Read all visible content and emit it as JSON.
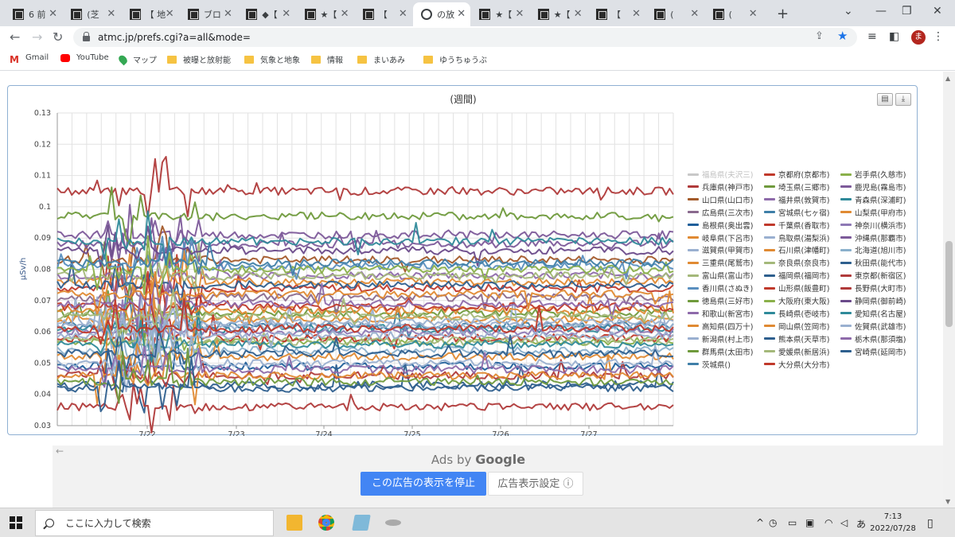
{
  "browser": {
    "tabs": [
      {
        "title": "6 前",
        "icon": "site-icon"
      },
      {
        "title": "(芝",
        "icon": "site-icon"
      },
      {
        "title": "【 地",
        "icon": "site-icon"
      },
      {
        "title": "ブロ",
        "icon": "info-icon"
      },
      {
        "title": "◆【",
        "icon": "site-icon"
      },
      {
        "title": "★【",
        "icon": "site-icon"
      },
      {
        "title": "【",
        "icon": "site-icon"
      },
      {
        "title": "の放",
        "icon": "globe-icon",
        "active": true
      },
      {
        "title": "★【",
        "icon": "site-icon"
      },
      {
        "title": "★【",
        "icon": "site-icon"
      },
      {
        "title": "【",
        "icon": "site-icon"
      },
      {
        "title": "(",
        "icon": "site-icon"
      },
      {
        "title": "(",
        "icon": "site-icon"
      }
    ],
    "url": "atmc.jp/prefs.cgi?a=all&mode=",
    "profile_initial": "ま",
    "bookmarks": [
      {
        "label": "Gmail",
        "icon": "gmail-icon"
      },
      {
        "label": "YouTube",
        "icon": "youtube-icon"
      },
      {
        "label": "マップ",
        "icon": "maps-icon"
      },
      {
        "label": "被曝と放射能",
        "icon": "folder-icon"
      },
      {
        "label": "気象と地象",
        "icon": "folder-icon"
      },
      {
        "label": "情報",
        "icon": "folder-icon"
      },
      {
        "label": "まいあみ",
        "icon": "folder-icon"
      },
      {
        "label": "ゆうちゅうぶ",
        "icon": "folder-icon"
      }
    ]
  },
  "chart_data": {
    "type": "line",
    "title": "(週間)",
    "ylabel": "μSv/h",
    "ylim": [
      0.03,
      0.13
    ],
    "yticks": [
      "0.03",
      "0.04",
      "0.05",
      "0.06",
      "0.07",
      "0.08",
      "0.09",
      "0.1",
      "0.11",
      "0.12",
      "0.13"
    ],
    "xticks": [
      "7/22",
      "7/23",
      "7/24",
      "7/25",
      "7/26",
      "7/27"
    ],
    "grid": true,
    "legend_position": "right",
    "series": [
      {
        "name": "福島県(夫沢三)",
        "color": "#c8c8c8",
        "dim": true,
        "level": null
      },
      {
        "name": "京都府(京都市)",
        "color": "#c0392b",
        "level": 0.074
      },
      {
        "name": "岩手県(久慈市)",
        "color": "#8ab04a",
        "level": 0.057
      },
      {
        "name": "兵庫県(神戸市)",
        "color": "#b03a3a",
        "level": 0.105
      },
      {
        "name": "埼玉県(三郷市)",
        "color": "#6f9a3c",
        "level": 0.066
      },
      {
        "name": "鹿児島(霧島市)",
        "color": "#7d5a9a",
        "level": 0.091
      },
      {
        "name": "山口県(山口市)",
        "color": "#a35a2a",
        "level": 0.083
      },
      {
        "name": "福井県(敦賀市)",
        "color": "#8e6aaa",
        "level": 0.078
      },
      {
        "name": "青森県(深浦町)",
        "color": "#2f8a9a",
        "level": 0.061
      },
      {
        "name": "広島県(三次市)",
        "color": "#8a6a8e",
        "level": 0.071
      },
      {
        "name": "宮城県(七ヶ宿)",
        "color": "#3f7fa8",
        "level": 0.062
      },
      {
        "name": "山梨県(甲府市)",
        "color": "#e08a33",
        "level": 0.064
      },
      {
        "name": "島根県(奥出雲)",
        "color": "#1f5f9a",
        "level": 0.049
      },
      {
        "name": "千葉県(香取市)",
        "color": "#c0392b",
        "level": 0.058
      },
      {
        "name": "神奈川(横浜市)",
        "color": "#8e79b5",
        "level": 0.06
      },
      {
        "name": "岐阜県(下呂市)",
        "color": "#e08a33",
        "level": 0.076
      },
      {
        "name": "鳥取県(湯梨浜)",
        "color": "#9ab0d0",
        "level": 0.062
      },
      {
        "name": "沖縄県(那覇市)",
        "color": "#7d5a9a",
        "level": 0.088
      },
      {
        "name": "滋賀県(甲賀市)",
        "color": "#9ab0d0",
        "level": 0.063
      },
      {
        "name": "石川県(津幡町)",
        "color": "#e08a33",
        "level": 0.067
      },
      {
        "name": "北海道(旭川市)",
        "color": "#8ab0cc",
        "level": 0.054
      },
      {
        "name": "三重県(尾鷲市)",
        "color": "#e08a33",
        "level": 0.052
      },
      {
        "name": "奈良県(奈良市)",
        "color": "#a4b87a",
        "level": 0.057
      },
      {
        "name": "秋田県(能代市)",
        "color": "#2e5f8e",
        "level": 0.043
      },
      {
        "name": "富山県(富山市)",
        "color": "#a4b87a",
        "level": 0.078
      },
      {
        "name": "福岡県(福岡市)",
        "color": "#2e5f8e",
        "level": 0.075
      },
      {
        "name": "東京都(新宿区)",
        "color": "#b03a3a",
        "level": 0.036
      },
      {
        "name": "香川県(さぬき)",
        "color": "#5a8fbf",
        "level": 0.081
      },
      {
        "name": "山形県(飯豊町)",
        "color": "#c0392b",
        "level": 0.068
      },
      {
        "name": "長野県(大町市)",
        "color": "#b03a3a",
        "level": 0.046
      },
      {
        "name": "徳島県(三好市)",
        "color": "#6f9a3c",
        "level": 0.097
      },
      {
        "name": "大阪府(東大阪)",
        "color": "#8ab04a",
        "level": 0.08
      },
      {
        "name": "静岡県(御前崎)",
        "color": "#6a4a8a",
        "level": 0.086
      },
      {
        "name": "和歌山(新宮市)",
        "color": "#8e6aaa",
        "level": 0.069
      },
      {
        "name": "長崎県(壱岐市)",
        "color": "#2f8a9a",
        "level": 0.089
      },
      {
        "name": "愛知県(名古屋)",
        "color": "#2f8a9a",
        "level": 0.056
      },
      {
        "name": "高知県(四万十)",
        "color": "#e08a33",
        "level": 0.046
      },
      {
        "name": "岡山県(笠岡市)",
        "color": "#e08a33",
        "level": 0.072
      },
      {
        "name": "佐賀県(武雄市)",
        "color": "#9ab0d0",
        "level": 0.05
      },
      {
        "name": "新潟県(村上市)",
        "color": "#9ab0d0",
        "level": 0.059
      },
      {
        "name": "熊本県(天草市)",
        "color": "#2e5f8e",
        "level": 0.053
      },
      {
        "name": "栃木県(那須塩)",
        "color": "#8e6aaa",
        "level": 0.048
      },
      {
        "name": "群馬県(太田市)",
        "color": "#6f9a3c",
        "level": 0.044
      },
      {
        "name": "愛媛県(新居浜)",
        "color": "#a4b87a",
        "level": 0.065
      },
      {
        "name": "宮崎県(延岡市)",
        "color": "#2e5f8e",
        "level": 0.042
      },
      {
        "name": "茨城県()",
        "color": "#3f7fa8",
        "level": 0.082
      },
      {
        "name": "大分県(大分市)",
        "color": "#c0392b",
        "level": 0.061
      }
    ]
  },
  "ads": {
    "ads_by": "Ads by",
    "google": "Google",
    "stop_button": "この広告の表示を停止",
    "settings_button": "広告表示設定 ⓘ"
  },
  "taskbar": {
    "search_placeholder": "ここに入力して検索",
    "time": "7:13",
    "date": "2022/07/28",
    "ime": "あ"
  }
}
